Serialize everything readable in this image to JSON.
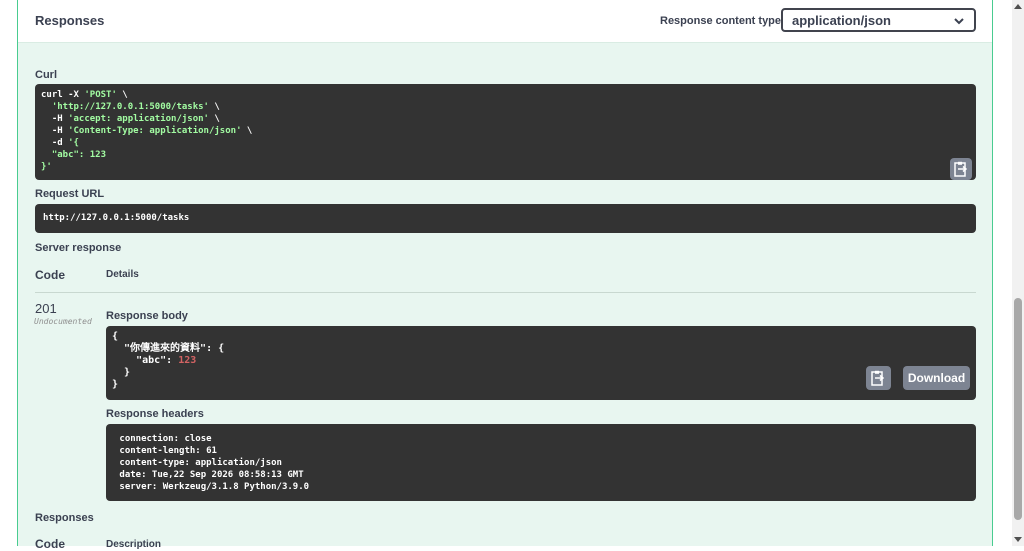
{
  "header": {
    "title": "Responses",
    "content_type_label": "Response content type",
    "content_type_value": "application/json"
  },
  "curl": {
    "label": "Curl",
    "lines": [
      {
        "parts": [
          {
            "t": "curl -X ",
            "c": "w"
          },
          {
            "t": "'POST'",
            "c": "s"
          },
          {
            "t": " \\",
            "c": "w"
          }
        ]
      },
      {
        "parts": [
          {
            "t": "  ",
            "c": "w"
          },
          {
            "t": "'http://127.0.0.1:5000/tasks'",
            "c": "s"
          },
          {
            "t": " \\",
            "c": "w"
          }
        ]
      },
      {
        "parts": [
          {
            "t": "  -H ",
            "c": "w"
          },
          {
            "t": "'accept: application/json'",
            "c": "s"
          },
          {
            "t": " \\",
            "c": "w"
          }
        ]
      },
      {
        "parts": [
          {
            "t": "  -H ",
            "c": "w"
          },
          {
            "t": "'Content-Type: application/json'",
            "c": "s"
          },
          {
            "t": " \\",
            "c": "w"
          }
        ]
      },
      {
        "parts": [
          {
            "t": "  -d ",
            "c": "w"
          },
          {
            "t": "'{",
            "c": "s"
          }
        ]
      },
      {
        "parts": [
          {
            "t": "  \"abc\": 123",
            "c": "s"
          }
        ]
      },
      {
        "parts": [
          {
            "t": "}'",
            "c": "s"
          }
        ]
      }
    ]
  },
  "request_url": {
    "label": "Request URL",
    "value": "http://127.0.0.1:5000/tasks"
  },
  "server_response": {
    "label": "Server response",
    "col_code": "Code",
    "col_details": "Details",
    "status_code": "201",
    "status_note": "Undocumented",
    "body_label": "Response body",
    "body_lines": [
      {
        "parts": [
          {
            "t": "{",
            "c": "w"
          }
        ]
      },
      {
        "parts": [
          {
            "t": "  \"你傳進來的資料\": {",
            "c": "w"
          }
        ]
      },
      {
        "parts": [
          {
            "t": "    \"abc\": ",
            "c": "w"
          },
          {
            "t": "123",
            "c": "n"
          }
        ]
      },
      {
        "parts": [
          {
            "t": "  }",
            "c": "w"
          }
        ]
      },
      {
        "parts": [
          {
            "t": "}",
            "c": "w"
          }
        ]
      }
    ],
    "download_label": "Download",
    "headers_label": "Response headers",
    "header_lines": [
      " connection: close ",
      " content-length: 61 ",
      " content-type: application/json ",
      " date: Tue,22 Sep 2026 08:58:13 GMT ",
      " server: Werkzeug/3.1.8 Python/3.9.0 "
    ]
  },
  "responses_section": {
    "label": "Responses",
    "col_code": "Code",
    "col_description": "Description"
  },
  "colors": {
    "panel_bg": "#e8f6f0",
    "panel_border": "#49cc90",
    "code_bg": "#333333",
    "string_color": "#a2fca2",
    "number_color": "#d36363",
    "button_bg": "#7d8492"
  },
  "icons": [
    "chevron-down-icon",
    "copy-icon"
  ]
}
